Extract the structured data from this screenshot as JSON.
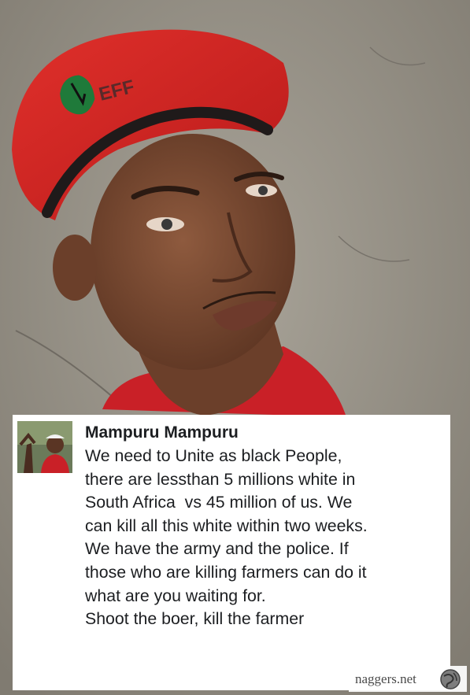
{
  "photo": {
    "cap_logo_text": "EFF",
    "colors": {
      "wall": "#8f8a80",
      "beret": "#d0201f",
      "shirt": "#c92027",
      "skin": "#7a4a32"
    }
  },
  "post": {
    "author_name": "Mampuru Mampuru",
    "lines": [
      "We need to Unite as black People,",
      "there are lessthan 5 millions white in",
      "South Africa  vs 45 million of us. We",
      "can kill all this white within two weeks.",
      "We have the army and the police. If",
      "those who are killing farmers can do it",
      "what are you waiting for.",
      "",
      "Shoot the boer, kill the farmer"
    ]
  },
  "watermark": {
    "text": "naggers.net",
    "icon": "globe-logo-icon"
  }
}
